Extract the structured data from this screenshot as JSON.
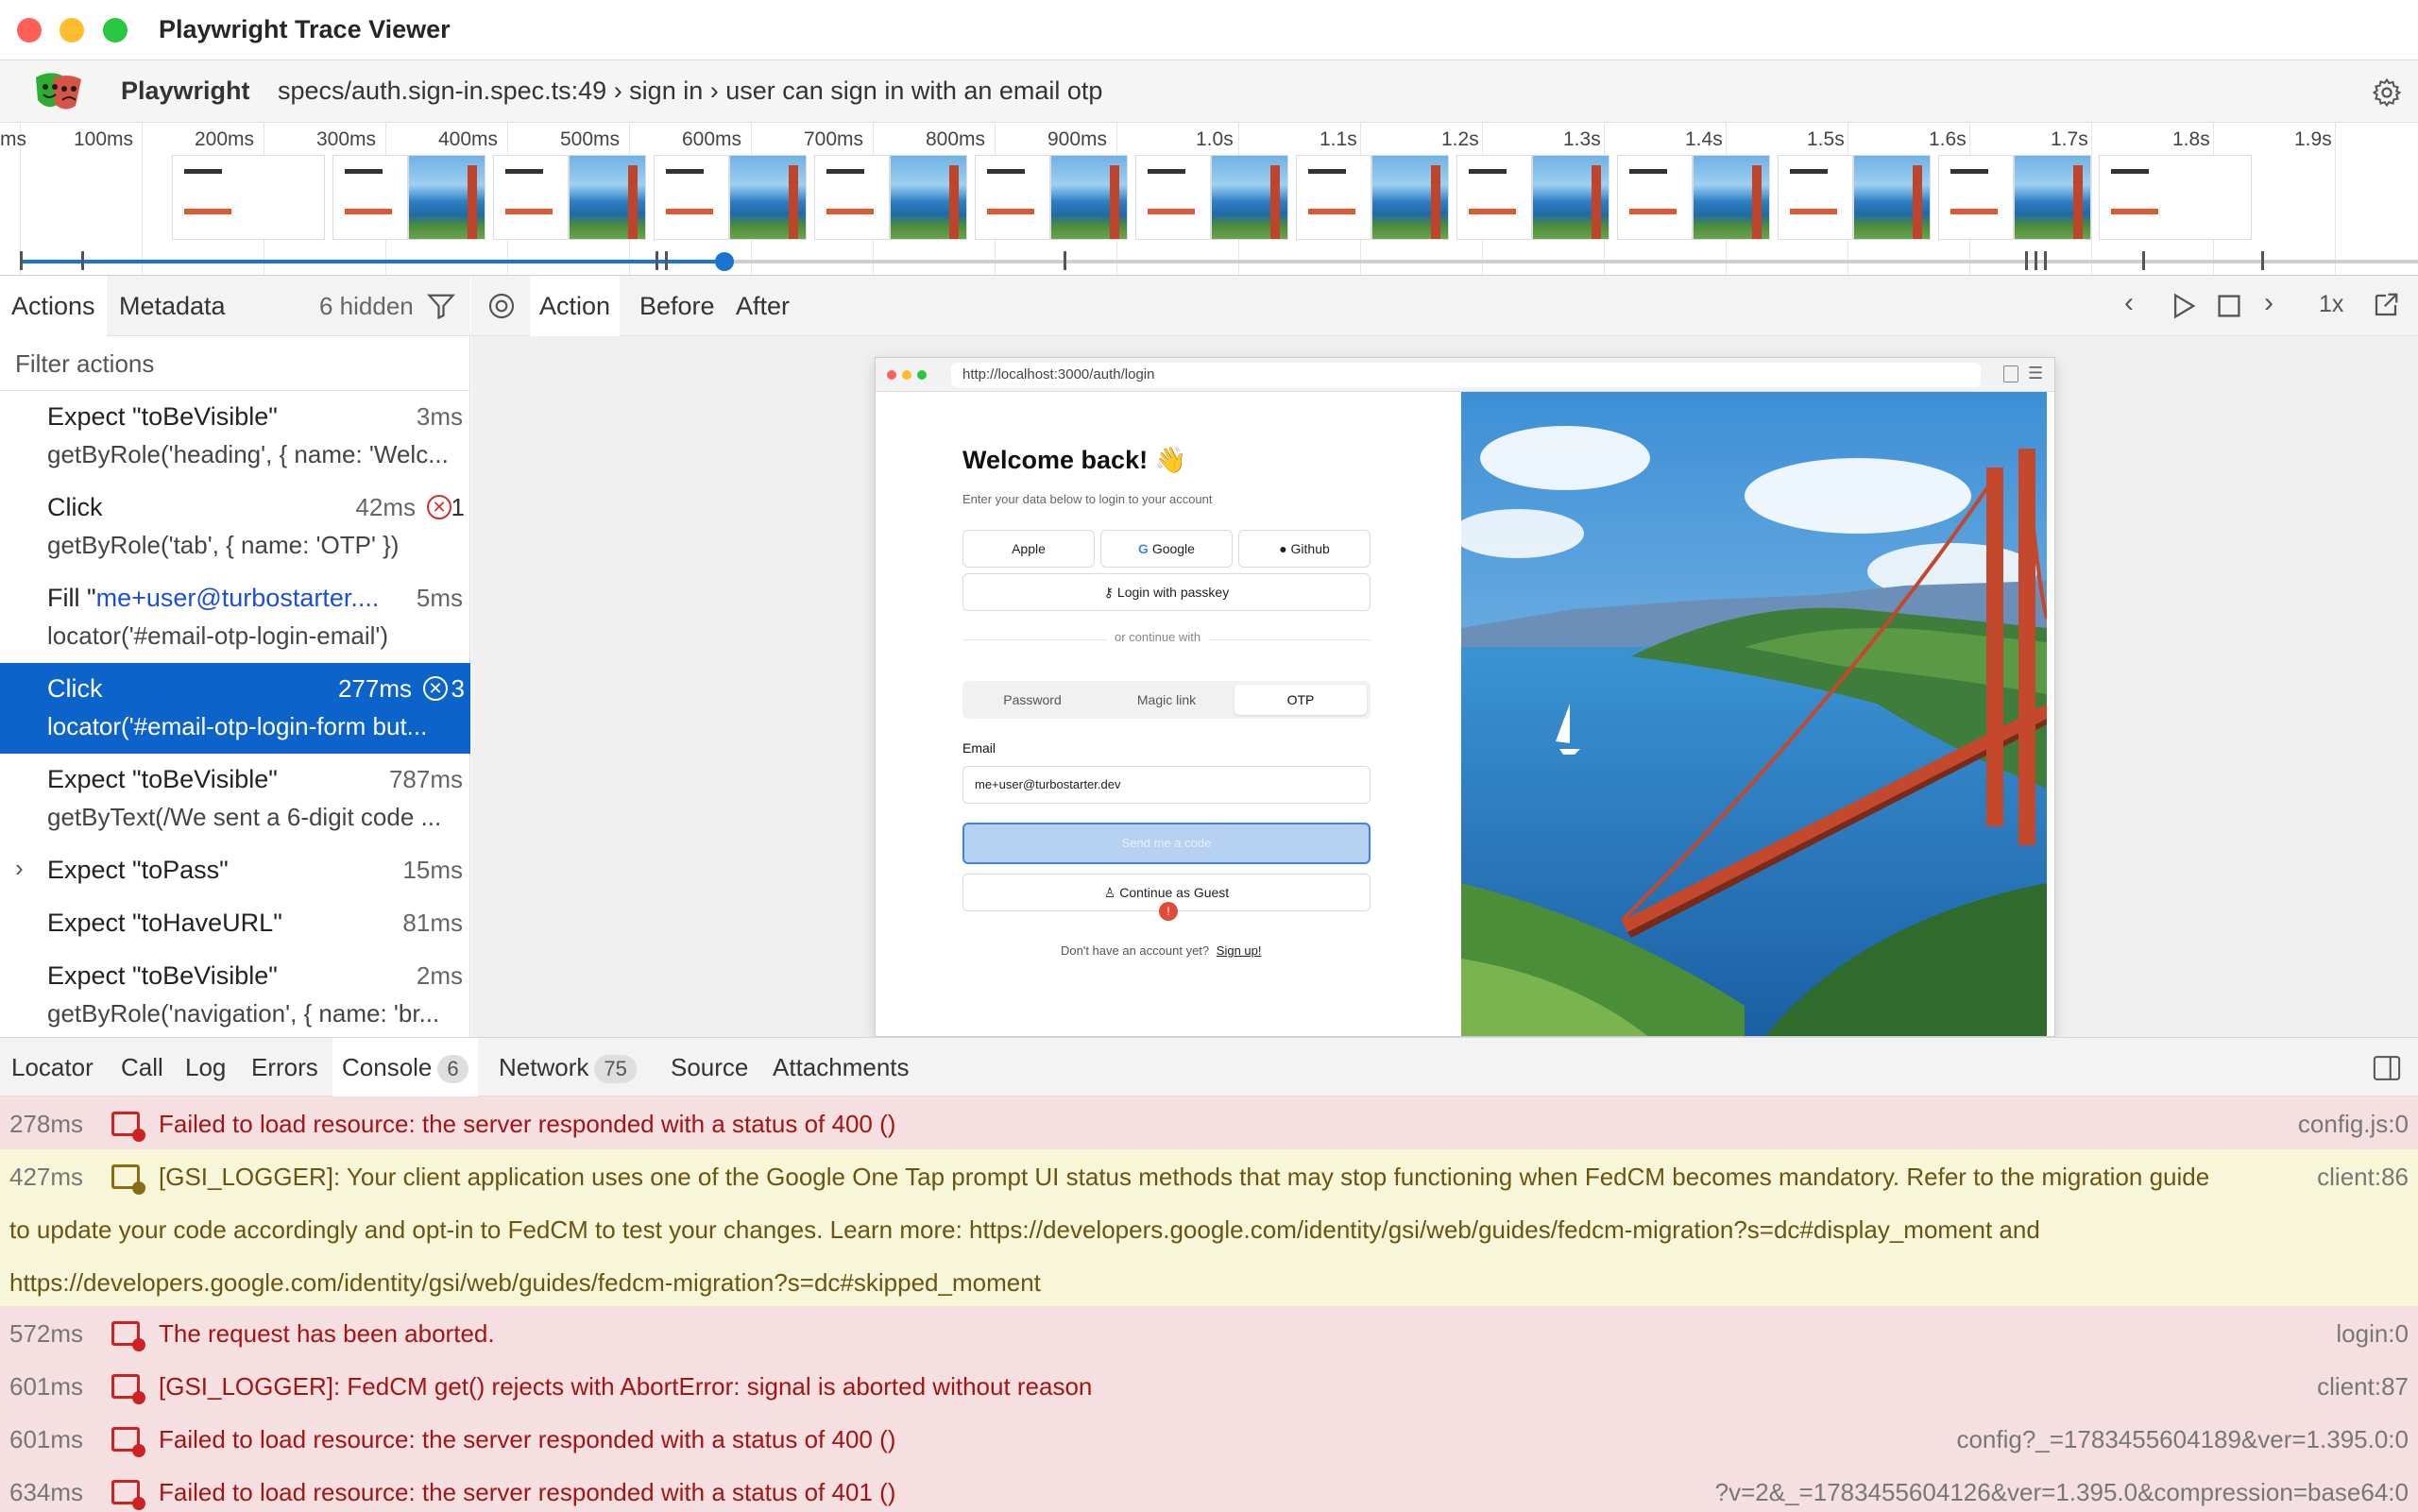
{
  "window": {
    "title": "Playwright Trace Viewer"
  },
  "header": {
    "brand": "Playwright",
    "breadcrumb": "specs/auth.sign-in.spec.ts:49 › sign in › user can sign in with an email otp"
  },
  "timeline": {
    "ticks": [
      "ms",
      "100ms",
      "200ms",
      "300ms",
      "400ms",
      "500ms",
      "600ms",
      "700ms",
      "800ms",
      "900ms",
      "1.0s",
      "1.1s",
      "1.2s",
      "1.3s",
      "1.4s",
      "1.5s",
      "1.6s",
      "1.7s",
      "1.8s",
      "1.9s"
    ],
    "progress": 0.3
  },
  "left_panel": {
    "tabs": [
      "Actions",
      "Metadata"
    ],
    "hidden_count": "6 hidden",
    "filter_placeholder": "Filter actions",
    "actions": [
      {
        "title": "Expect \"toBeVisible\"",
        "duration": "3ms",
        "detail": "getByRole('heading', { name: 'Welc..."
      },
      {
        "title": "Click",
        "duration": "42ms",
        "errors": "1",
        "detail": "getByRole('tab', { name: 'OTP' })"
      },
      {
        "title_prefix": "Fill \"",
        "title_value": "me+user@turbostarter....",
        "duration": "5ms",
        "detail": "locator('#email-otp-login-email')"
      },
      {
        "title": "Click",
        "duration": "277ms",
        "errors": "3",
        "detail": "locator('#email-otp-login-form but..."
      },
      {
        "title": "Expect \"toBeVisible\"",
        "duration": "787ms",
        "detail": "getByText(/We sent a 6-digit code ..."
      },
      {
        "title": "Expect \"toPass\"",
        "duration": "15ms",
        "detail": ""
      },
      {
        "title": "Expect \"toHaveURL\"",
        "duration": "81ms",
        "detail": ""
      },
      {
        "title": "Expect \"toBeVisible\"",
        "duration": "2ms",
        "detail": "getByRole('navigation', { name: 'br..."
      }
    ]
  },
  "right_panel": {
    "tabs": [
      "Action",
      "Before",
      "After"
    ],
    "speed": "1x"
  },
  "browser": {
    "url": "http://localhost:3000/auth/login",
    "heading": "Welcome back! 👋",
    "subheading": "Enter your data below to login to your account",
    "providers": [
      "Apple",
      "Google",
      "Github"
    ],
    "passkey": "Login with passkey",
    "divider": "or continue with",
    "auth_tabs": [
      "Password",
      "Magic link",
      "OTP"
    ],
    "email_label": "Email",
    "email_value": "me+user@turbostarter.dev",
    "submit": "Send me a code",
    "guest": "Continue as Guest",
    "signup_text": "Don't have an account yet?",
    "signup_link": "Sign up!"
  },
  "bottom_panel": {
    "tabs": [
      "Locator",
      "Call",
      "Log",
      "Errors",
      "Console",
      "Network",
      "Source",
      "Attachments"
    ],
    "console_count": "6",
    "network_count": "75",
    "logs": [
      {
        "level": "error",
        "time": "278ms",
        "msg": "Failed to load resource: the server responded with a status of 400 ()",
        "src": "config.js:0"
      },
      {
        "level": "warning",
        "time": "427ms",
        "msg": "[GSI_LOGGER]: Your client application uses one of the Google One Tap prompt UI status methods that may stop functioning when FedCM becomes mandatory. Refer to the migration guide",
        "msg2": "to update your code accordingly and opt-in to FedCM to test your changes. Learn more: https://developers.google.com/identity/gsi/web/guides/fedcm-migration?s=dc#display_moment and",
        "msg3": "https://developers.google.com/identity/gsi/web/guides/fedcm-migration?s=dc#skipped_moment",
        "src": "client:86"
      },
      {
        "level": "error",
        "time": "572ms",
        "msg": "The request has been aborted.",
        "src": "login:0"
      },
      {
        "level": "error",
        "time": "601ms",
        "msg": "[GSI_LOGGER]: FedCM get() rejects with AbortError: signal is aborted without reason",
        "src": "client:87"
      },
      {
        "level": "error",
        "time": "601ms",
        "msg": "Failed to load resource: the server responded with a status of 400 ()",
        "src": "config?_=1783455604189&ver=1.395.0:0"
      },
      {
        "level": "error",
        "time": "634ms",
        "msg": "Failed to load resource: the server responded with a status of 401 ()",
        "src": "?v=2&_=1783455604126&ver=1.395.0&compression=base64:0"
      }
    ]
  },
  "colors": {
    "accent": "#0c63c9",
    "error_bg": "#f6dfe1",
    "warn_bg": "#f7f6d9"
  }
}
